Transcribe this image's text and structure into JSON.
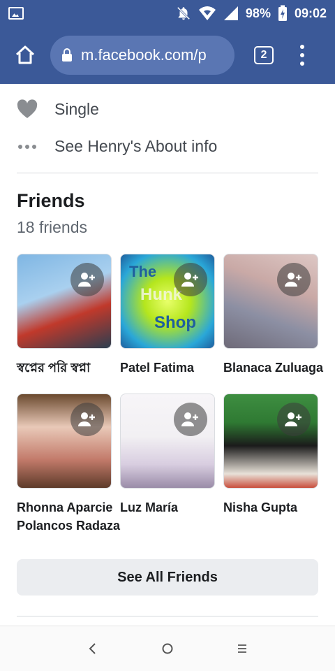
{
  "status_bar": {
    "battery": "98%",
    "time": "09:02",
    "icons": [
      "image-icon",
      "bell-off-icon",
      "wifi-icon",
      "signal-icon",
      "battery-charging-icon"
    ]
  },
  "browser": {
    "url": "m.facebook.com/p",
    "tab_count": "2"
  },
  "about": {
    "relationship": "Single",
    "see_about": "See Henry's About info"
  },
  "friends": {
    "title": "Friends",
    "count": "18 friends",
    "items": [
      {
        "name": "স্বপ্নের পরি স্বপ্না",
        "colors": [
          "#6fa8d6",
          "#c0392b",
          "#2c3e50"
        ]
      },
      {
        "name": "Patel Fatima",
        "colors": [
          "#b5e61d",
          "#2aa7d8",
          "#1f5f9e"
        ],
        "overlay": [
          "The",
          "Hunk",
          "Shop"
        ]
      },
      {
        "name": "Blanaca Zuluaga",
        "colors": [
          "#c9a9a6",
          "#8c8fa3",
          "#6e6a78"
        ]
      },
      {
        "name": "Rhonna Aparcie Polancos Radaza",
        "name_line1": "Rhonna Aparcie",
        "name_line2": "Polancos Radaza",
        "colors": [
          "#e9c9b8",
          "#c27a6a",
          "#5d3b2a"
        ]
      },
      {
        "name": "Luz María",
        "colors": [
          "#f2f0f3",
          "#d8cde0",
          "#9a8ca8"
        ]
      },
      {
        "name": "Nisha Gupta",
        "colors": [
          "#3e8e41",
          "#1b1b1b",
          "#e8e1d8"
        ]
      }
    ],
    "see_all": "See All Friends"
  },
  "nav": {
    "back_symbol": "‹",
    "home_symbol": "○",
    "recents_symbol": "≡"
  },
  "colors": {
    "facebook_blue": "#3b5998",
    "button_gray": "#ebedf0"
  }
}
